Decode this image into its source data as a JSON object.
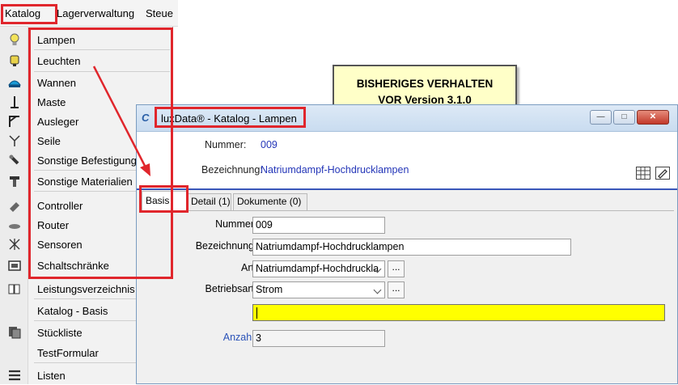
{
  "menubar": {
    "items": [
      {
        "label": "Katalog"
      },
      {
        "label": "Lagerverwaltung"
      },
      {
        "label": "Steue"
      }
    ]
  },
  "menu": {
    "items": [
      {
        "label": "Lampen",
        "icon": "bulb-icon"
      },
      {
        "label": "Leuchten",
        "icon": "luminaire-icon"
      },
      {
        "label": "Wannen",
        "icon": "tub-icon"
      },
      {
        "label": "Maste",
        "icon": "mast-icon"
      },
      {
        "label": "Ausleger",
        "icon": "bracket-arm-icon"
      },
      {
        "label": "Seile",
        "icon": "rope-icon"
      },
      {
        "label": "Sonstige Befestigung",
        "icon": "fixture-icon"
      },
      {
        "label": "Sonstige Materialien",
        "icon": "material-icon"
      },
      {
        "label": "Controller",
        "icon": "controller-icon"
      },
      {
        "label": "Router",
        "icon": "router-icon"
      },
      {
        "label": "Sensoren",
        "icon": "sensor-icon"
      },
      {
        "label": "Schaltschränke",
        "icon": "cabinet-icon"
      },
      {
        "label": "Leistungsverzeichnis",
        "icon": "book-icon"
      },
      {
        "label": "Katalog - Basis",
        "icon": ""
      },
      {
        "label": "Stückliste",
        "icon": "parts-list-icon"
      },
      {
        "label": "TestFormular",
        "icon": ""
      },
      {
        "label": "Listen",
        "icon": "list-icon"
      }
    ]
  },
  "note": {
    "line1": "BISHERIGES VERHALTEN",
    "line2": "VOR Version 3.1.0"
  },
  "window": {
    "title": "luxData® - Katalog - Lampen",
    "controls": {
      "minimize": "—",
      "maximize": "□",
      "close": "✕"
    },
    "header": {
      "nummer_label": "Nummer:",
      "nummer_value": "009",
      "bezeichnung_label": "Bezeichnung:",
      "bezeichnung_value": "Natriumdampf-Hochdrucklampen"
    },
    "tabs": [
      {
        "label": "Basis"
      },
      {
        "label": "Detail (1)"
      },
      {
        "label": "Dokumente (0)"
      }
    ],
    "form": {
      "nummer_label": "Nummer",
      "nummer_value": "009",
      "bezeichnung_label": "Bezeichnung",
      "bezeichnung_value": "Natriumdampf-Hochdrucklampen",
      "art_label": "Art",
      "art_value": "Natriumdampf-Hochdruckla",
      "betriebsart_label": "Betriebsart",
      "betriebsart_value": "Strom",
      "dots": "...",
      "anzahl_label": "Anzahl",
      "anzahl_value": "3"
    }
  },
  "colors": {
    "highlight": "#e0262c",
    "note_bg": "#ffffc8",
    "yellow_field": "#ffff00",
    "link_blue": "#2436b8"
  }
}
